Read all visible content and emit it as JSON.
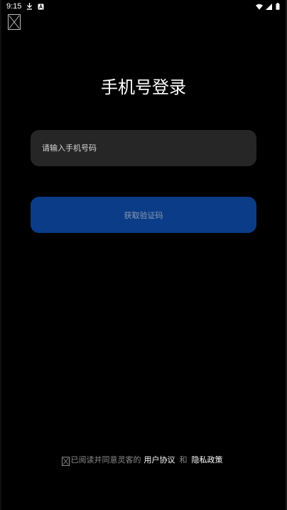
{
  "status_bar": {
    "time": "9:15",
    "left_icons": [
      "download-icon",
      "notification-a-icon"
    ],
    "right_icons": [
      "wifi-icon",
      "signal-icon",
      "battery-icon"
    ]
  },
  "header": {
    "close_icon": "broken-image-icon"
  },
  "login": {
    "title": "手机号登录",
    "phone_placeholder": "请输入手机号码",
    "phone_value": "",
    "get_code_label": "获取验证码"
  },
  "agreement": {
    "prefix": "已阅读并同意灵客的",
    "user_agreement": "用户协议",
    "conjunction": "和",
    "privacy_policy": "隐私政策",
    "checked": false
  },
  "colors": {
    "background": "#000000",
    "input_bg": "#262626",
    "button_bg": "#0b3c87",
    "button_text": "#8c9bb3",
    "muted_text": "#8a8a8a",
    "link_text": "#ffffff"
  }
}
